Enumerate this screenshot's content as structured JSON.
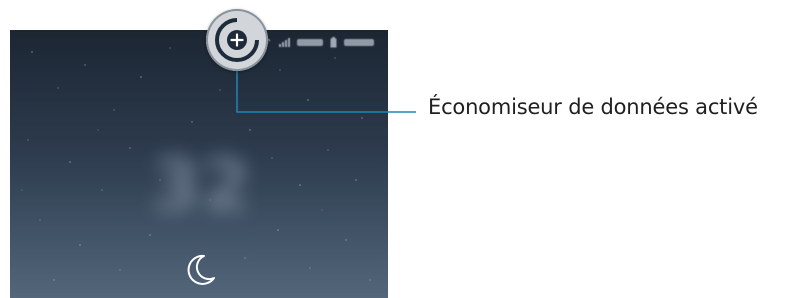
{
  "callout": {
    "label": "Économiseur de données activé"
  },
  "lockscreen": {
    "clock_blurred": "32",
    "status_icons": [
      "wifi-icon",
      "signal-icon",
      "battery-icon"
    ]
  },
  "icons": {
    "badge": "data-saver-icon",
    "moon": "moon-icon"
  },
  "colors": {
    "callout_line": "#1f86b8",
    "badge_ring": "#1e2b3a",
    "badge_bg": "#d2d6db"
  }
}
